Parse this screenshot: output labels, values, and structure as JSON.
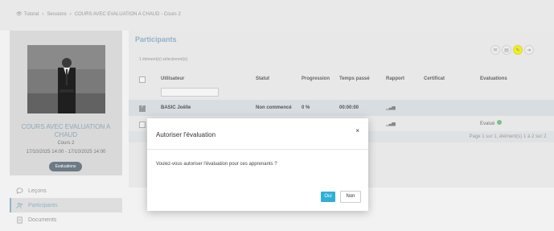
{
  "breadcrumb": {
    "home": "Tutorat",
    "items": [
      "Sessions",
      "COURS AVEC EVALUATION A CHAUD - Cours 2"
    ]
  },
  "course": {
    "title": "COURS AVEC EVALUATION A CHAUD",
    "subtitle": "Cours 2",
    "dates": "17/10/2025 14:00 - 17/10/2025 14:00",
    "badge": "Evaluations"
  },
  "nav": [
    {
      "label": "Leçons",
      "icon": "chat-bubble-icon"
    },
    {
      "label": "Participants",
      "icon": "users-icon",
      "active": true
    },
    {
      "label": "Documents",
      "icon": "document-icon"
    }
  ],
  "main": {
    "title": "Participants",
    "selected_text": "1 élément(s) sélectionné(s)",
    "actions": [
      "mail-icon",
      "report-icon",
      "authorize-evaluation-icon",
      "sign-out-icon"
    ],
    "columns": [
      "Utilisateur",
      "Statut",
      "Progression",
      "Temps passé",
      "Rapport",
      "Certificat",
      "Evaluations"
    ],
    "rows": [
      {
        "user": "BASIC Joëlle",
        "status": "Non commencé",
        "progress": "0 %",
        "time": "00:00:00",
        "evaluation": ""
      },
      {
        "user": "",
        "status": "",
        "progress": "",
        "time": "",
        "evaluation": "Evalué"
      }
    ],
    "pagination": "Page 1 sur 1, élément(s) 1 à 2 sur 2."
  },
  "modal": {
    "title": "Autoriser l'évaluation",
    "close": "×",
    "body": "Voulez-vous autoriser l'évaluation pour ces apprenants ?",
    "yes": "Oui",
    "no": "Non"
  },
  "colors": {
    "accent": "#2eb0d6",
    "title": "#8fb3c8",
    "highlight": "#f0f020",
    "success": "#7cc08b"
  }
}
